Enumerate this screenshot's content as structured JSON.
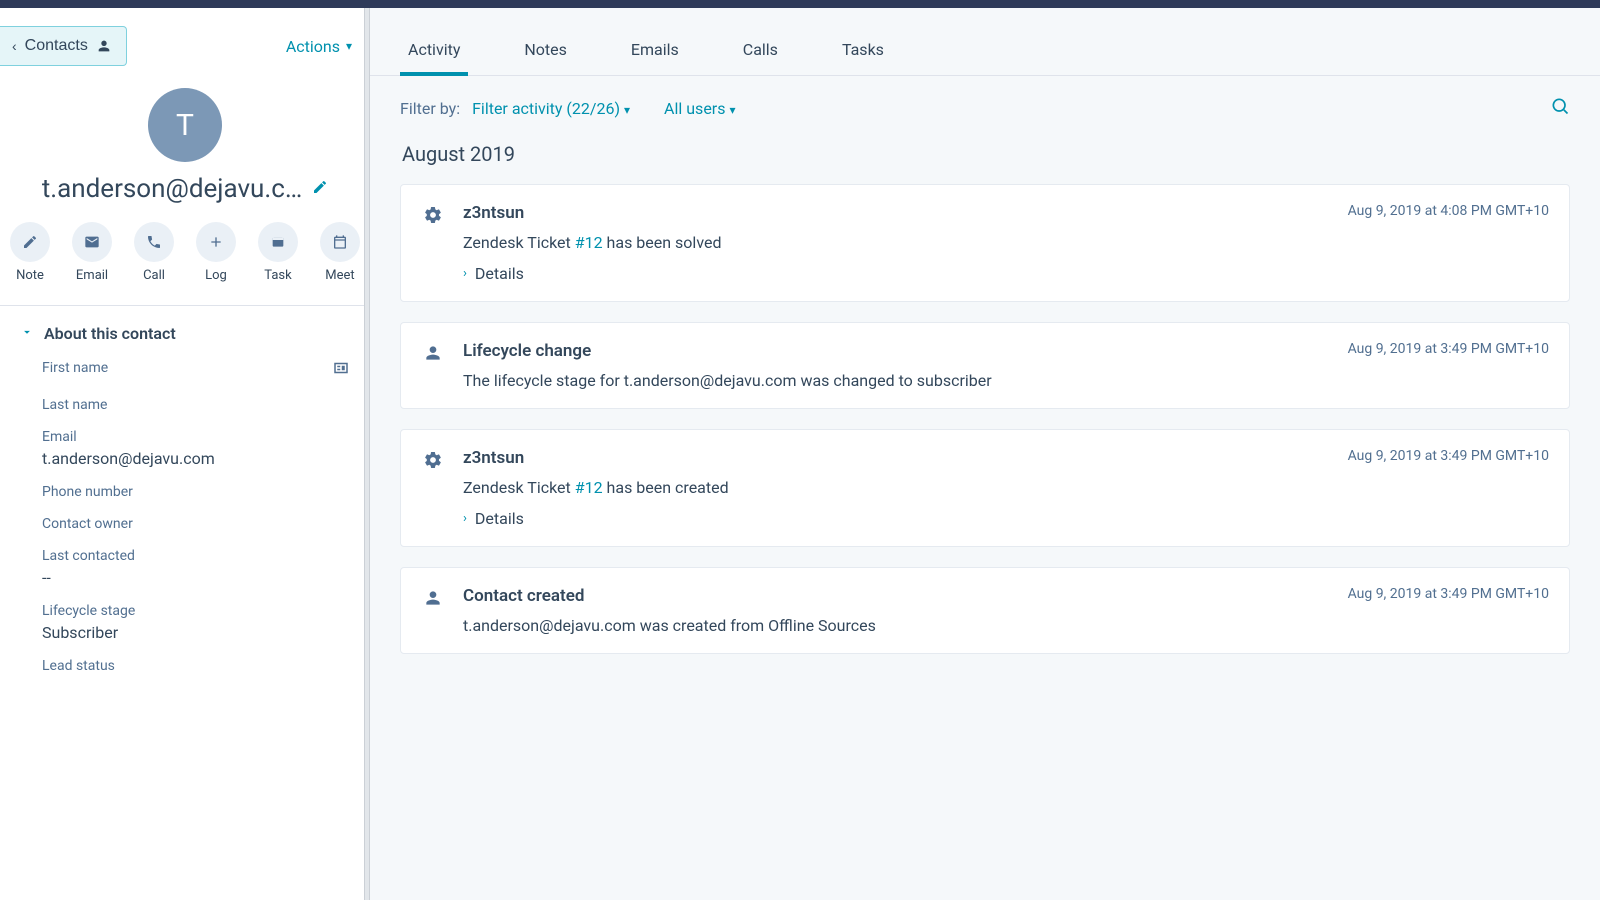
{
  "breadcrumb": {
    "label": "Contacts"
  },
  "actions": {
    "label": "Actions"
  },
  "contact": {
    "initial": "T",
    "display_name": "t.anderson@dejavu.c…"
  },
  "action_icons": [
    {
      "key": "note",
      "label": "Note"
    },
    {
      "key": "email",
      "label": "Email"
    },
    {
      "key": "call",
      "label": "Call"
    },
    {
      "key": "log",
      "label": "Log"
    },
    {
      "key": "task",
      "label": "Task"
    },
    {
      "key": "meet",
      "label": "Meet"
    }
  ],
  "about": {
    "section_title": "About this contact",
    "fields": {
      "first_name": {
        "label": "First name",
        "value": ""
      },
      "last_name": {
        "label": "Last name",
        "value": ""
      },
      "email": {
        "label": "Email",
        "value": "t.anderson@dejavu.com"
      },
      "phone": {
        "label": "Phone number",
        "value": ""
      },
      "owner": {
        "label": "Contact owner",
        "value": ""
      },
      "last_contacted": {
        "label": "Last contacted",
        "value": "--"
      },
      "lifecycle": {
        "label": "Lifecycle stage",
        "value": "Subscriber"
      },
      "lead_status": {
        "label": "Lead status",
        "value": ""
      }
    }
  },
  "tabs": {
    "items": [
      "Activity",
      "Notes",
      "Emails",
      "Calls",
      "Tasks"
    ],
    "active_index": 0
  },
  "filter": {
    "label": "Filter by:",
    "activity": "Filter activity (22/26)",
    "users": "All users"
  },
  "feed": {
    "month": "August 2019",
    "items": [
      {
        "icon": "gear",
        "title": "z3ntsun",
        "timestamp": "Aug 9, 2019 at 4:08 PM GMT+10",
        "text_before": "Zendesk Ticket ",
        "ticket": "#12",
        "text_after": " has been solved",
        "details": "Details"
      },
      {
        "icon": "person",
        "title": "Lifecycle change",
        "timestamp": "Aug 9, 2019 at 3:49 PM GMT+10",
        "plain_text": "The lifecycle stage for t.anderson@dejavu.com was changed to subscriber"
      },
      {
        "icon": "gear",
        "title": "z3ntsun",
        "timestamp": "Aug 9, 2019 at 3:49 PM GMT+10",
        "text_before": "Zendesk Ticket ",
        "ticket": "#12",
        "text_after": " has been created",
        "details": "Details"
      },
      {
        "icon": "person",
        "title": "Contact created",
        "timestamp": "Aug 9, 2019 at 3:49 PM GMT+10",
        "plain_text": "t.anderson@dejavu.com was created from Offline Sources"
      }
    ]
  }
}
